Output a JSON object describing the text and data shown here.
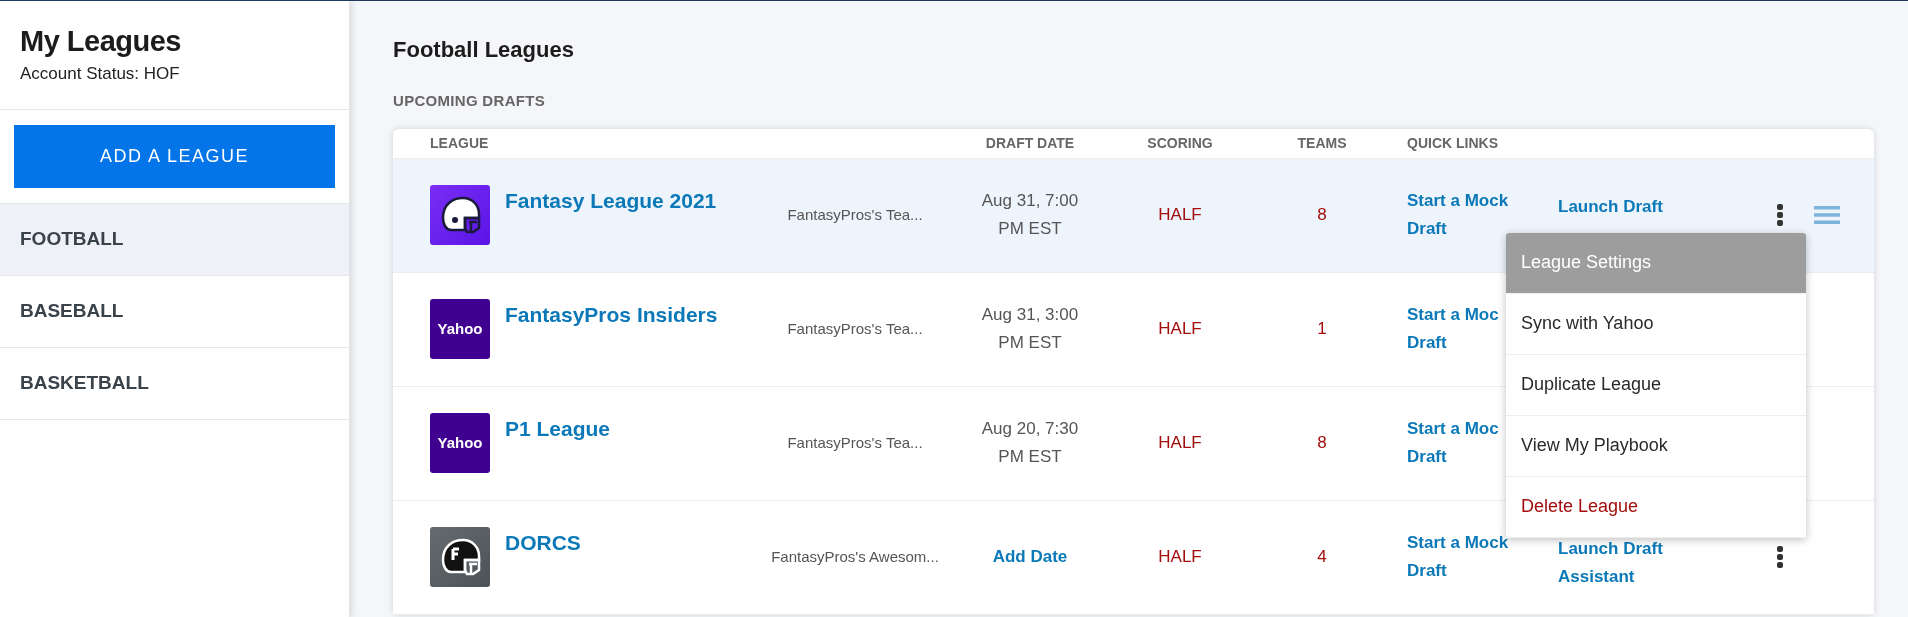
{
  "sidebar": {
    "title": "My Leagues",
    "account_status": "Account Status: HOF",
    "add_button": "ADD A LEAGUE",
    "items": [
      {
        "label": "FOOTBALL",
        "selected": true
      },
      {
        "label": "BASEBALL",
        "selected": false
      },
      {
        "label": "BASKETBALL",
        "selected": false
      }
    ]
  },
  "main": {
    "title": "Football Leagues",
    "section": "UPCOMING DRAFTS",
    "table": {
      "columns": [
        "LEAGUE",
        "DRAFT DATE",
        "SCORING",
        "TEAMS",
        "QUICK LINKS"
      ],
      "rows": [
        {
          "logo": {
            "kind": "helmet"
          },
          "name": "Fantasy League 2021",
          "team": "FantasyPros's Tea...",
          "date": {
            "kind": "text",
            "lines": [
              "Aug 31, 7:00",
              "PM EST"
            ]
          },
          "scoring": "HALF",
          "teams": "8",
          "mock_link": [
            "Start a Mock",
            "Draft"
          ],
          "launch_link": [
            "Launch Draft"
          ],
          "hovered": true,
          "more_button": true,
          "menu_open": true
        },
        {
          "logo": {
            "kind": "yahoo",
            "text": "Yahoo"
          },
          "name": "FantasyPros Insiders",
          "team": "FantasyPros's Tea...",
          "date": {
            "kind": "text",
            "lines": [
              "Aug 31, 3:00",
              "PM EST"
            ]
          },
          "scoring": "HALF",
          "teams": "1",
          "mock_link": [
            "Start a Moc",
            "Draft"
          ],
          "hovered": false,
          "menu_open": false
        },
        {
          "logo": {
            "kind": "yahoo",
            "text": "Yahoo"
          },
          "name": "P1 League",
          "team": "FantasyPros's Tea...",
          "date": {
            "kind": "text",
            "lines": [
              "Aug 20, 7:30",
              "PM EST"
            ]
          },
          "scoring": "HALF",
          "teams": "8",
          "mock_link": [
            "Start a Moc",
            "Draft"
          ],
          "hovered": false,
          "menu_open": false
        },
        {
          "logo": {
            "kind": "helmet-dark"
          },
          "name": "DORCS",
          "team": "FantasyPros's Awesom...",
          "date": {
            "kind": "link",
            "lines": [
              "Add Date"
            ]
          },
          "scoring": "HALF",
          "teams": "4",
          "mock_link": [
            "Start a Mock",
            "Draft"
          ],
          "launch_link": [
            "Launch Draft",
            "Assistant"
          ],
          "hovered": false,
          "more_button": true,
          "menu_open": false
        }
      ]
    },
    "row_menu": {
      "items": [
        {
          "label": "League Settings",
          "selected": true,
          "kind": "normal"
        },
        {
          "label": "Sync with Yahoo",
          "selected": false,
          "kind": "normal"
        },
        {
          "label": "Duplicate League",
          "selected": false,
          "kind": "normal"
        },
        {
          "label": "View My Playbook",
          "selected": false,
          "kind": "normal"
        },
        {
          "label": "Delete League",
          "selected": false,
          "kind": "danger"
        }
      ]
    }
  }
}
